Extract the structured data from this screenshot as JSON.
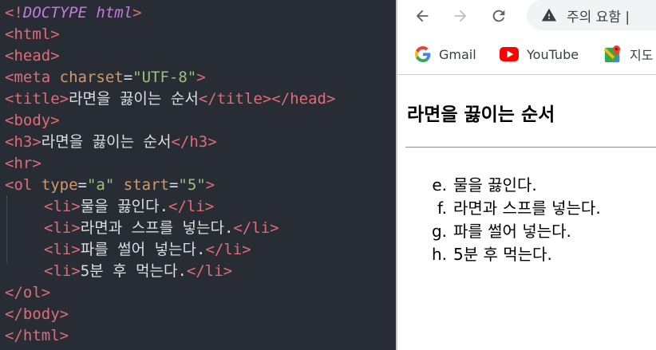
{
  "editor": {
    "lines": [
      {
        "indent": false,
        "tokens": [
          {
            "t": "tag",
            "v": "<!"
          },
          {
            "t": "doctype",
            "v": "DOCTYPE html"
          },
          {
            "t": "tag",
            "v": ">"
          }
        ]
      },
      {
        "indent": false,
        "tokens": [
          {
            "t": "tag",
            "v": "<html>"
          }
        ]
      },
      {
        "indent": false,
        "tokens": [
          {
            "t": "tag",
            "v": "<head>"
          }
        ]
      },
      {
        "indent": false,
        "tokens": [
          {
            "t": "tag",
            "v": "<meta "
          },
          {
            "t": "attr",
            "v": "charset"
          },
          {
            "t": "txt",
            "v": "="
          },
          {
            "t": "str",
            "v": "\"UTF-8\""
          },
          {
            "t": "tag",
            "v": ">"
          }
        ]
      },
      {
        "indent": false,
        "tokens": [
          {
            "t": "tag",
            "v": "<title>"
          },
          {
            "t": "txt",
            "v": "라면을 끓이는 순서"
          },
          {
            "t": "tag",
            "v": "</title></head>"
          }
        ]
      },
      {
        "indent": false,
        "tokens": [
          {
            "t": "tag",
            "v": "<body>"
          }
        ]
      },
      {
        "indent": false,
        "tokens": [
          {
            "t": "tag",
            "v": "<h3>"
          },
          {
            "t": "txt",
            "v": "라면을 끓이는 순서"
          },
          {
            "t": "tag",
            "v": "</h3>"
          }
        ]
      },
      {
        "indent": false,
        "tokens": [
          {
            "t": "tag",
            "v": "<hr>"
          }
        ]
      },
      {
        "indent": false,
        "tokens": [
          {
            "t": "tag",
            "v": "<ol "
          },
          {
            "t": "attr",
            "v": "type"
          },
          {
            "t": "txt",
            "v": "="
          },
          {
            "t": "str",
            "v": "\"a\""
          },
          {
            "t": "txt",
            "v": " "
          },
          {
            "t": "attr",
            "v": "start"
          },
          {
            "t": "txt",
            "v": "="
          },
          {
            "t": "str",
            "v": "\"5\""
          },
          {
            "t": "tag",
            "v": ">"
          }
        ]
      },
      {
        "indent": true,
        "tokens": [
          {
            "t": "tag",
            "v": "<li>"
          },
          {
            "t": "txt",
            "v": "물을 끓인다."
          },
          {
            "t": "tag",
            "v": "</li>"
          }
        ]
      },
      {
        "indent": true,
        "tokens": [
          {
            "t": "tag",
            "v": "<li>"
          },
          {
            "t": "txt",
            "v": "라면과 스프를 넣는다."
          },
          {
            "t": "tag",
            "v": "</li>"
          }
        ]
      },
      {
        "indent": true,
        "tokens": [
          {
            "t": "tag",
            "v": "<li>"
          },
          {
            "t": "txt",
            "v": "파를 썰어 넣는다."
          },
          {
            "t": "tag",
            "v": "</li>"
          }
        ]
      },
      {
        "indent": true,
        "tokens": [
          {
            "t": "tag",
            "v": "<li>"
          },
          {
            "t": "txt",
            "v": "5분 후 먹는다."
          },
          {
            "t": "tag",
            "v": "</li>"
          }
        ]
      },
      {
        "indent": false,
        "tokens": [
          {
            "t": "tag",
            "v": "</ol>"
          }
        ]
      },
      {
        "indent": false,
        "tokens": [
          {
            "t": "tag",
            "v": "</body>"
          }
        ]
      },
      {
        "indent": false,
        "tokens": [
          {
            "t": "tag",
            "v": "</html>"
          }
        ]
      }
    ],
    "colors": {
      "background": "#282c34",
      "tag": "#e06c75",
      "doctype": "#c678dd",
      "attr": "#d19a66",
      "string": "#98c379",
      "text": "#dcdfe4"
    }
  },
  "browser": {
    "back_icon": "arrow-left-icon",
    "forward_icon": "arrow-right-icon",
    "reload_icon": "reload-icon",
    "address_bar": {
      "icon": "warning-icon",
      "text": "주의 요함 |"
    },
    "bookmarks": [
      {
        "icon": "google-icon",
        "label": "Gmail"
      },
      {
        "icon": "youtube-icon",
        "label": "YouTube"
      },
      {
        "icon": "maps-icon",
        "label": "지도"
      }
    ],
    "page": {
      "heading": "라면을 끓이는 순서",
      "list": [
        {
          "marker": "e.",
          "text": "물을 끓인다."
        },
        {
          "marker": "f.",
          "text": "라면과 스프를 넣는다."
        },
        {
          "marker": "g.",
          "text": "파를 썰어 넣는다."
        },
        {
          "marker": "h.",
          "text": "5분 후 먹는다."
        }
      ]
    }
  }
}
